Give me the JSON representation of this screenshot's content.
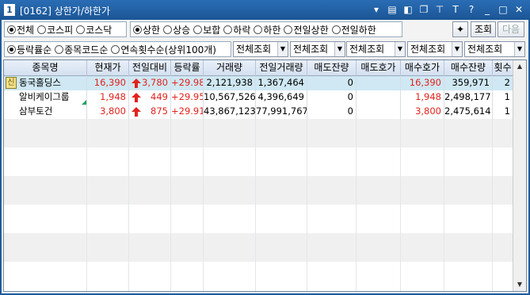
{
  "window": {
    "number": "1",
    "title": "[0162] 상한가/하한가"
  },
  "market_filter": [
    "전체",
    "코스피",
    "코스닥"
  ],
  "market_selected": 0,
  "price_filter": [
    "상한",
    "상승",
    "보합",
    "하락",
    "하한",
    "전일상한",
    "전일하한"
  ],
  "price_selected": 0,
  "sort_filter": [
    "등락률순",
    "종목코드순",
    "연속횟수순(상위100개)"
  ],
  "sort_selected": 0,
  "combos": [
    "전체조회",
    "전체조회",
    "전체조회",
    "전체조회",
    "전체조회"
  ],
  "buttons": {
    "query": "조회",
    "next": "다음"
  },
  "table": {
    "headers": [
      "종목명",
      "현재가",
      "전일대비",
      "등락률",
      "거래량",
      "전일거래량",
      "매도잔량",
      "매도호가",
      "매수호가",
      "매수잔량",
      "횟수"
    ],
    "rows": [
      {
        "badge": "신",
        "name": "동국홀딩스",
        "price": "16,390",
        "change": "3,780",
        "rate": "+29.98",
        "volume": "2,121,938",
        "prev_volume": "1,367,464",
        "ask_qty": "0",
        "ask": "",
        "bid": "16,390",
        "bid_qty": "359,971",
        "count": "2"
      },
      {
        "badge": "",
        "name": "알비케이그룹",
        "price": "1,948",
        "change": "449",
        "rate": "+29.95",
        "volume": "10,567,526",
        "prev_volume": "4,396,649",
        "ask_qty": "0",
        "ask": "",
        "bid": "1,948",
        "bid_qty": "2,498,177",
        "count": "1"
      },
      {
        "badge": "",
        "name": "삼부토건",
        "price": "3,800",
        "change": "875",
        "rate": "+29.91",
        "volume": "43,867,123",
        "prev_volume": "77,991,767",
        "ask_qty": "0",
        "ask": "",
        "bid": "3,800",
        "bid_qty": "2,475,614",
        "count": "1"
      }
    ]
  },
  "colors": {
    "title_bar": "#1b5595",
    "up": "#e0241f",
    "selected_row": "#cfe8f3"
  }
}
